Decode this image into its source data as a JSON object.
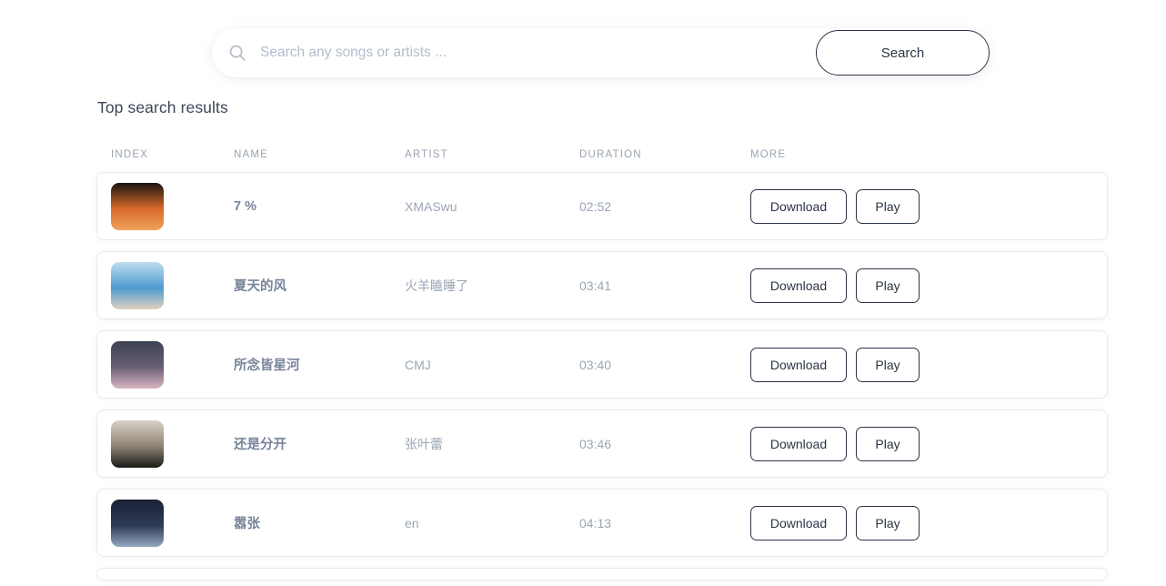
{
  "search": {
    "placeholder": "Search any songs or artists ...",
    "value": "",
    "icon": "search-icon",
    "button_label": "Search"
  },
  "results": {
    "title": "Top search results",
    "columns": {
      "index": "INDEX",
      "name": "NAME",
      "artist": "ARTIST",
      "duration": "DURATION",
      "more": "MORE"
    },
    "actions": {
      "download": "Download",
      "play": "Play"
    },
    "rows": [
      {
        "name": "7 %",
        "artist": "XMASwu",
        "duration": "02:52",
        "thumb_colors": [
          "#1a1410",
          "#d9692a",
          "#f0a35c"
        ]
      },
      {
        "name": "夏天的风",
        "artist": "火羊瞌睡了",
        "duration": "03:41",
        "thumb_colors": [
          "#bfdcee",
          "#4e9bd0",
          "#dfd2be"
        ]
      },
      {
        "name": "所念皆星河",
        "artist": "CMJ",
        "duration": "03:40",
        "thumb_colors": [
          "#3c4152",
          "#6b5f74",
          "#d8b6c2"
        ]
      },
      {
        "name": "还是分开",
        "artist": "张叶蕾",
        "duration": "03:46",
        "thumb_colors": [
          "#d8d2c6",
          "#8d8274",
          "#1c1a17"
        ]
      },
      {
        "name": "嚣张",
        "artist": "en",
        "duration": "04:13",
        "thumb_colors": [
          "#1b2236",
          "#2d3a55",
          "#93a7bd"
        ]
      }
    ]
  },
  "colors": {
    "page_background": "#ffffff",
    "card_background": "#ffffff",
    "accent_border": "#2b3445",
    "header_text": "#9aa3b2",
    "name_text": "#78849a",
    "muted_text": "#9aa5b5"
  }
}
